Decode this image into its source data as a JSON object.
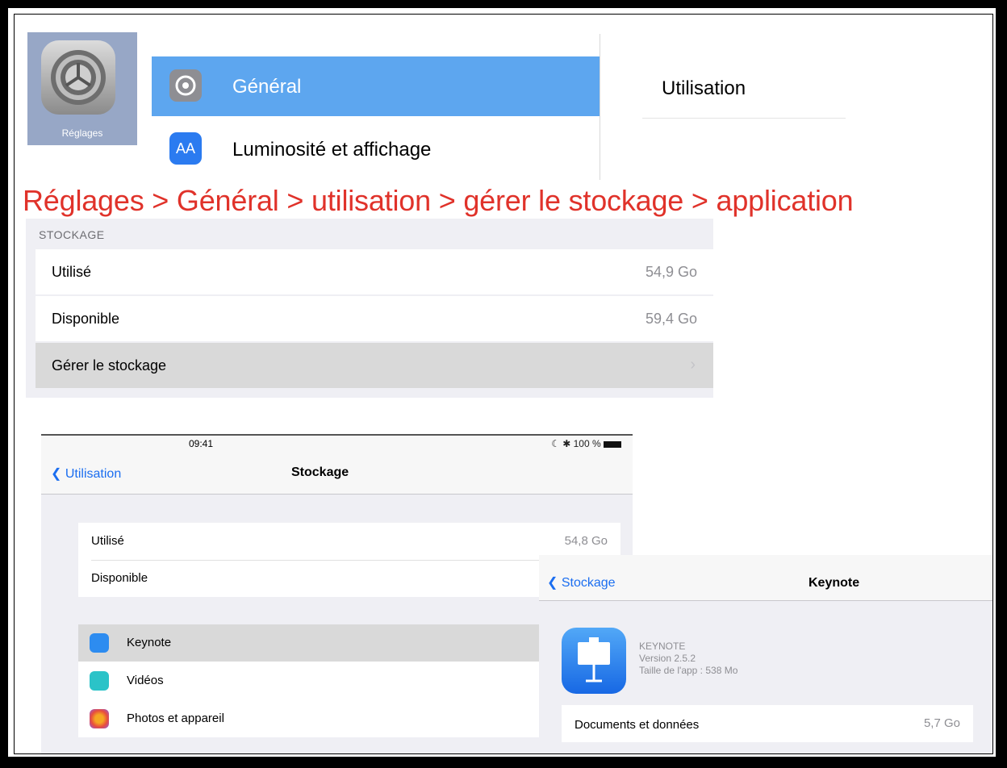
{
  "settings_app": {
    "icon_label": "Réglages"
  },
  "settings_list": {
    "items": [
      {
        "label": "Général",
        "icon": "gear-icon",
        "selected": true
      },
      {
        "label": "Luminosité et affichage",
        "icon": "brightness-aa-icon",
        "icon_text": "AA"
      }
    ],
    "detail_header": "Utilisation"
  },
  "breadcrumb": "Réglages > Général > utilisation > gérer le stockage > application",
  "storage_section": {
    "header": "STOCKAGE",
    "rows": [
      {
        "label": "Utilisé",
        "value": "54,9 Go"
      },
      {
        "label": "Disponible",
        "value": "59,4 Go"
      },
      {
        "label": "Gérer le stockage",
        "value": ""
      }
    ]
  },
  "storage_screen": {
    "time": "09:41",
    "battery": "☾ ✱ 100 %",
    "back_label": "Utilisation",
    "title": "Stockage",
    "summary": [
      {
        "label": "Utilisé",
        "value": "54,8 Go"
      },
      {
        "label": "Disponible",
        "value": ""
      }
    ],
    "apps": [
      {
        "label": "Keynote",
        "color": "#2d8cf0"
      },
      {
        "label": "Vidéos",
        "color": "#2bc3c8"
      },
      {
        "label": "Photos et appareil",
        "color": "#f5a623"
      }
    ]
  },
  "keynote_screen": {
    "back_label": "Stockage",
    "title": "Keynote",
    "app_name": "KEYNOTE",
    "version": "Version 2.5.2",
    "size": "Taille de l'app : 538 Mo",
    "docs_label": "Documents et données",
    "docs_value": "5,7 Go"
  }
}
